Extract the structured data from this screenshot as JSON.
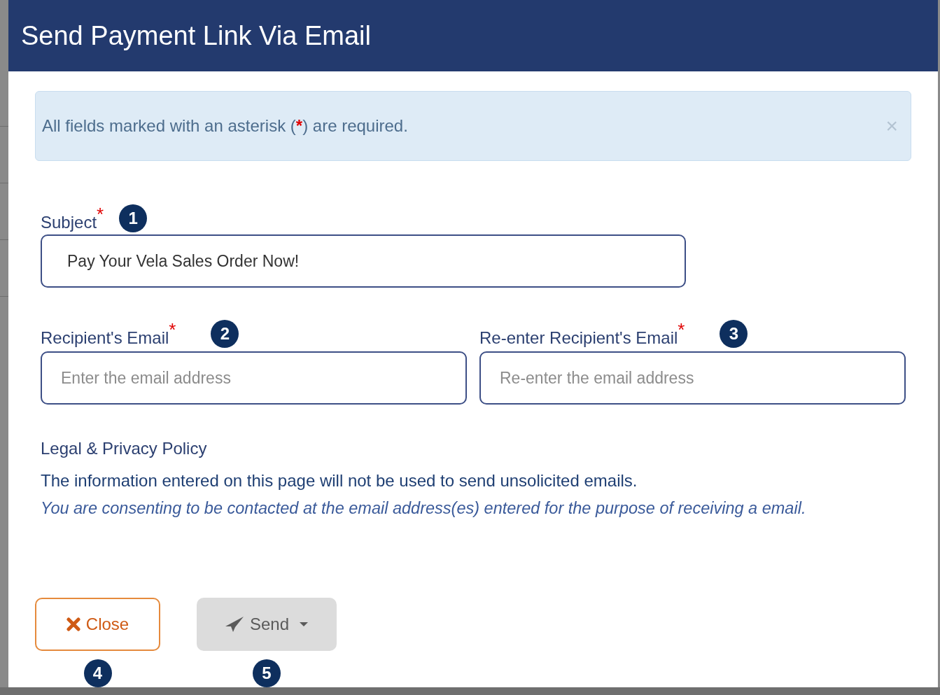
{
  "dialog": {
    "title": "Send Payment Link Via Email"
  },
  "alert": {
    "before": "All fields marked with an asterisk (",
    "mark": "*",
    "after": ") are required.",
    "close": "×"
  },
  "subject": {
    "label": "Subject",
    "mark": "*",
    "step": "1",
    "value": "Pay Your Vela Sales Order Now!"
  },
  "recipients": [
    {
      "label": "Recipient's Email",
      "mark": "*",
      "step": "2",
      "placeholder": "Enter the email address"
    },
    {
      "label": "Re-enter Recipient's Email",
      "mark": "*",
      "step": "3",
      "placeholder": "Re-enter the email address"
    }
  ],
  "legal": {
    "heading": "Legal & Privacy Policy",
    "statement": "The information entered on this page will not be used to send unsolicited emails.",
    "consent": "You are consenting to be contacted at the email address(es) entered for the purpose of receiving a email."
  },
  "buttons": [
    {
      "kind": "close",
      "label": "Close",
      "step": "4"
    },
    {
      "kind": "send",
      "label": "Send",
      "step": "5"
    }
  ]
}
